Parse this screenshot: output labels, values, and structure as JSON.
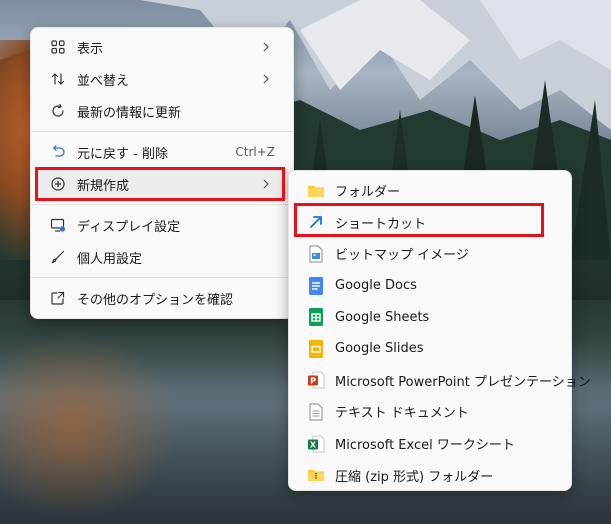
{
  "main_menu": {
    "items": [
      {
        "label": "表示",
        "icon": "grid-view-icon",
        "submenu": true
      },
      {
        "label": "並べ替え",
        "icon": "sort-icon",
        "submenu": true
      },
      {
        "label": "最新の情報に更新",
        "icon": "refresh-icon"
      },
      {
        "label": "元に戻す - 削除",
        "icon": "undo-icon",
        "shortcut": "Ctrl+Z"
      },
      {
        "label": "新規作成",
        "icon": "plus-circle-icon",
        "submenu": true,
        "highlighted": true
      },
      {
        "label": "ディスプレイ設定",
        "icon": "display-settings-icon"
      },
      {
        "label": "個人用設定",
        "icon": "brush-icon"
      },
      {
        "label": "その他のオプションを確認",
        "icon": "show-more-options-icon"
      }
    ]
  },
  "sub_menu": {
    "items": [
      {
        "label": "フォルダー",
        "icon": "folder-icon"
      },
      {
        "label": "ショートカット",
        "icon": "shortcut-arrow-icon",
        "highlighted": true
      },
      {
        "label": "ビットマップ イメージ",
        "icon": "bitmap-image-icon"
      },
      {
        "label": "Google Docs",
        "icon": "google-docs-icon"
      },
      {
        "label": "Google Sheets",
        "icon": "google-sheets-icon"
      },
      {
        "label": "Google Slides",
        "icon": "google-slides-icon"
      },
      {
        "label": "Microsoft PowerPoint プレゼンテーション",
        "icon": "powerpoint-icon"
      },
      {
        "label": "テキスト ドキュメント",
        "icon": "text-document-icon"
      },
      {
        "label": "Microsoft Excel ワークシート",
        "icon": "excel-icon"
      },
      {
        "label": "圧縮 (zip 形式) フォルダー",
        "icon": "zip-folder-icon"
      }
    ]
  },
  "colors": {
    "highlight_box": "#e8101a",
    "menu_bg": "#f9f9f9",
    "docs_blue": "#4285f4",
    "sheets_green": "#0f9d58",
    "slides_yellow": "#f4b400",
    "powerpoint_red": "#c43e1c",
    "excel_green": "#107c41",
    "folder_yellow": "#f8c640"
  }
}
